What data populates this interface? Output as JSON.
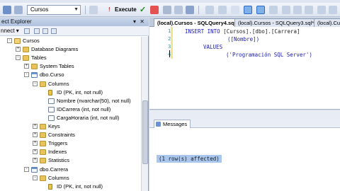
{
  "toolbar": {
    "database_selected": "Cursos",
    "execute_label": "Execute"
  },
  "object_explorer": {
    "title": "ect Explorer",
    "connect_label": "nnect ▾",
    "tree": [
      {
        "label": "Cursos",
        "exp": "-",
        "icon": "database"
      },
      {
        "label": "Database Diagrams",
        "exp": "+",
        "icon": "folder"
      },
      {
        "label": "Tables",
        "exp": "-",
        "icon": "folder"
      },
      {
        "label": "System Tables",
        "exp": "+",
        "icon": "folder"
      },
      {
        "label": "dbo.Curso",
        "exp": "-",
        "icon": "table"
      },
      {
        "label": "Columns",
        "exp": "-",
        "icon": "folder"
      },
      {
        "label": "ID (PK, int, not null)",
        "exp": "",
        "icon": "key"
      },
      {
        "label": "Nombre (nvarchar(50), not null)",
        "exp": "",
        "icon": "column"
      },
      {
        "label": "IDCarrera (int, not null)",
        "exp": "",
        "icon": "column"
      },
      {
        "label": "CargaHoraria (int, not null)",
        "exp": "",
        "icon": "column"
      },
      {
        "label": "Keys",
        "exp": "+",
        "icon": "folder"
      },
      {
        "label": "Constraints",
        "exp": "+",
        "icon": "folder"
      },
      {
        "label": "Triggers",
        "exp": "+",
        "icon": "folder"
      },
      {
        "label": "Indexes",
        "exp": "+",
        "icon": "folder"
      },
      {
        "label": "Statistics",
        "exp": "+",
        "icon": "folder"
      },
      {
        "label": "dbo.Carrera",
        "exp": "-",
        "icon": "table"
      },
      {
        "label": "Columns",
        "exp": "-",
        "icon": "folder"
      },
      {
        "label": "ID (PK, int, not null)",
        "exp": "",
        "icon": "key"
      }
    ]
  },
  "tabs": [
    {
      "label": "(local).Cursos - SQLQuery4.sql*",
      "active": true
    },
    {
      "label": "(local).Cursos - SQLQuery3.sql*",
      "active": false
    },
    {
      "label": "(local).Cursos",
      "active": false
    }
  ],
  "editor": {
    "line_numbers": [
      "1",
      "2",
      "3",
      "4"
    ],
    "line1_kw": "INSERT INTO",
    "line1_obj": " [Cursos].[dbo].[Carrera]",
    "line2": "([Nombre])",
    "line3": "VALUES",
    "line4": "('Programación SQL Server')"
  },
  "messages": {
    "tab_label": "Messages",
    "text": "(1 row(s) affected)"
  }
}
